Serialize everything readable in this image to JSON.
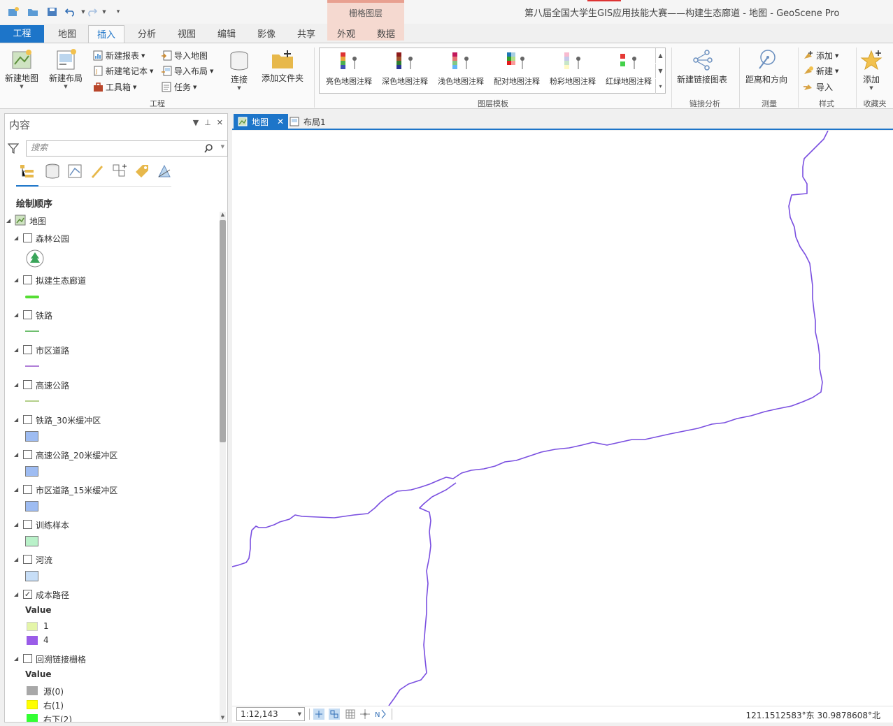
{
  "app": {
    "title": "第八届全国大学生GIS应用技能大赛——构建生态廊道 - 地图 - GeoScene Pro",
    "context_group": "栅格图层"
  },
  "tabs": [
    "工程",
    "地图",
    "插入",
    "分析",
    "视图",
    "编辑",
    "影像",
    "共享",
    "外观",
    "数据"
  ],
  "ribbon": {
    "new_map": "新建地图",
    "new_layout": "新建布局",
    "new_report": "新建报表",
    "new_notebook": "新建笔记本",
    "toolbox": "工具箱",
    "import_map": "导入地图",
    "import_layout": "导入布局",
    "task": "任务",
    "connect": "连接",
    "add_folder": "添加文件夹",
    "group_project": "工程",
    "templates": [
      "亮色地图注释",
      "深色地图注释",
      "浅色地图注释",
      "配对地图注释",
      "粉彩地图注释",
      "红绿地图注释"
    ],
    "group_templates": "图层模板",
    "new_link_chart": "新建链接图表",
    "group_link": "链接分析",
    "distance_direction": "距离和方向",
    "group_measure": "测量",
    "style_add": "添加",
    "style_new": "新建",
    "style_import": "导入",
    "group_style": "样式",
    "fav_add": "添加",
    "group_fav": "收藏夹"
  },
  "contents": {
    "title": "内容",
    "search_placeholder": "搜索",
    "draw_order": "绘制顺序",
    "map_name": "地图",
    "layers": [
      {
        "name": "森林公园",
        "checked": false
      },
      {
        "name": "拟建生态廊道",
        "checked": false
      },
      {
        "name": "铁路",
        "checked": false
      },
      {
        "name": "市区道路",
        "checked": false
      },
      {
        "name": "高速公路",
        "checked": false
      },
      {
        "name": "铁路_30米缓冲区",
        "checked": false
      },
      {
        "name": "高速公路_20米缓冲区",
        "checked": false
      },
      {
        "name": "市区道路_15米缓冲区",
        "checked": false
      },
      {
        "name": "训练样本",
        "checked": false
      },
      {
        "name": "河流",
        "checked": false
      },
      {
        "name": "成本路径",
        "checked": true
      },
      {
        "name": "回溯链接栅格",
        "checked": false
      }
    ],
    "cost_path": {
      "heading": "Value",
      "labels": [
        "1",
        "4"
      ],
      "colors": [
        "#e4f5a8",
        "#9a5ce8"
      ]
    },
    "backlink": {
      "heading": "Value",
      "labels": [
        "源(0)",
        "右(1)",
        "右下(2)"
      ],
      "colors": [
        "#a8a8a8",
        "#ffff00",
        "#33ff33"
      ]
    },
    "symbol_colors": {
      "corridor": "#55dd33",
      "railway": "#6fbf6f",
      "urban_road": "#b07fd8",
      "highway": "#b4cf8a",
      "buffer": "#9ebcf2",
      "training": "#b9f1c9",
      "river": "#c7def7"
    }
  },
  "view_tabs": [
    "地图",
    "布局1"
  ],
  "status": {
    "scale": "1:12,143",
    "coords": "121.1512583°东 30.9878608°北"
  },
  "colors": {
    "accent": "#1d75c9",
    "path": "#7a4fe0"
  }
}
